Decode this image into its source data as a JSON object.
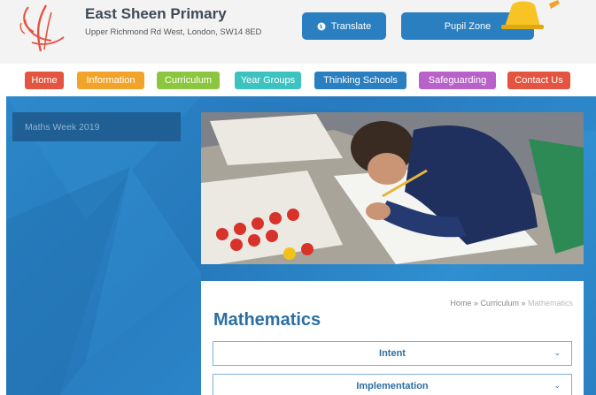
{
  "header": {
    "school_name": "East Sheen Primary",
    "address": "Upper Richmond Rd West, London, SW14 8ED",
    "translate_label": "Translate",
    "pupil_zone_label": "Pupil Zone"
  },
  "nav": {
    "items": [
      {
        "label": "Home",
        "color": "#e35441"
      },
      {
        "label": "Information",
        "color": "#f2a42a"
      },
      {
        "label": "Curriculum",
        "color": "#8cc63e"
      },
      {
        "label": "Year Groups",
        "color": "#3cc3c0"
      },
      {
        "label": "Thinking Schools",
        "color": "#2a7fc0"
      },
      {
        "label": "Safeguarding",
        "color": "#b861c8"
      },
      {
        "label": "Contact Us",
        "color": "#e35441"
      }
    ]
  },
  "sidebar": {
    "items": [
      {
        "label": "Maths Week 2019"
      }
    ]
  },
  "content": {
    "breadcrumb": {
      "home": "Home",
      "sep": " » ",
      "parent": "Curriculum",
      "current": "Mathematics"
    },
    "title": "Mathematics",
    "accordions": [
      {
        "label": "Intent"
      },
      {
        "label": "Implementation"
      }
    ]
  },
  "colors": {
    "brand_blue": "#2a7fc0",
    "title_blue": "#2b6ea3"
  }
}
